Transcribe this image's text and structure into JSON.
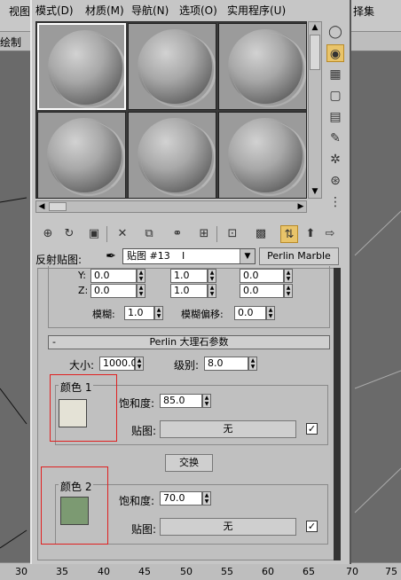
{
  "background": {
    "left_labels": [
      "视图",
      "绘制"
    ],
    "right_label": "择集",
    "ruler": [
      "30",
      "35",
      "40",
      "45",
      "50",
      "55",
      "60",
      "65",
      "70",
      "75"
    ]
  },
  "menubar": {
    "items": [
      "模式(D)",
      "材质(M)",
      "导航(N)",
      "选项(O)",
      "实用程序(U)"
    ]
  },
  "map_row": {
    "label": "反射贴图:",
    "map_name": "贴图 #13",
    "map_type": "Perlin Marble"
  },
  "coords": {
    "y_label": "Y:",
    "z_label": "Z:",
    "y_values": [
      "0.0",
      "1.0",
      "0.0"
    ],
    "z_values": [
      "0.0",
      "1.0",
      "0.0"
    ],
    "blur_label": "模糊:",
    "blur_value": "1.0",
    "blur_offset_label": "模糊偏移:",
    "blur_offset_value": "0.0"
  },
  "perlin": {
    "collapse_symbol": "-",
    "title": "Perlin 大理石参数",
    "size_label": "大小:",
    "size_value": "1000.0",
    "levels_label": "级别:",
    "levels_value": "8.0",
    "color1": {
      "label": "颜色 1",
      "saturation_label": "饱和度:",
      "saturation_value": "85.0",
      "map_label": "贴图:",
      "map_button": "无",
      "checked": true,
      "swatch_color": "#e4e2d6"
    },
    "swap_button": "交换",
    "color2": {
      "label": "颜色 2",
      "saturation_label": "饱和度:",
      "saturation_value": "70.0",
      "map_label": "贴图:",
      "map_button": "无",
      "checked": true,
      "swatch_color": "#7c9a72"
    }
  },
  "icons": {
    "side": [
      "sphere-sample-icon",
      "backlight-icon",
      "checker-background-icon",
      "sample-uv-tiling-icon",
      "video-color-check-icon",
      "make-preview-icon",
      "options-icon",
      "select-by-material-icon",
      "material-navigator-icon"
    ],
    "toolbar": [
      "get-material-icon",
      "put-to-scene-icon",
      "assign-material-icon",
      "reset-map-icon",
      "make-copy-icon",
      "make-unique-icon",
      "put-to-library-icon",
      "material-id-channel-icon",
      "show-map-in-viewport-icon",
      "show-end-result-icon",
      "go-to-parent-icon",
      "go-forward-icon"
    ]
  },
  "colors": {
    "accent_active": "#e9c46a",
    "highlight_box": "#e02020"
  }
}
